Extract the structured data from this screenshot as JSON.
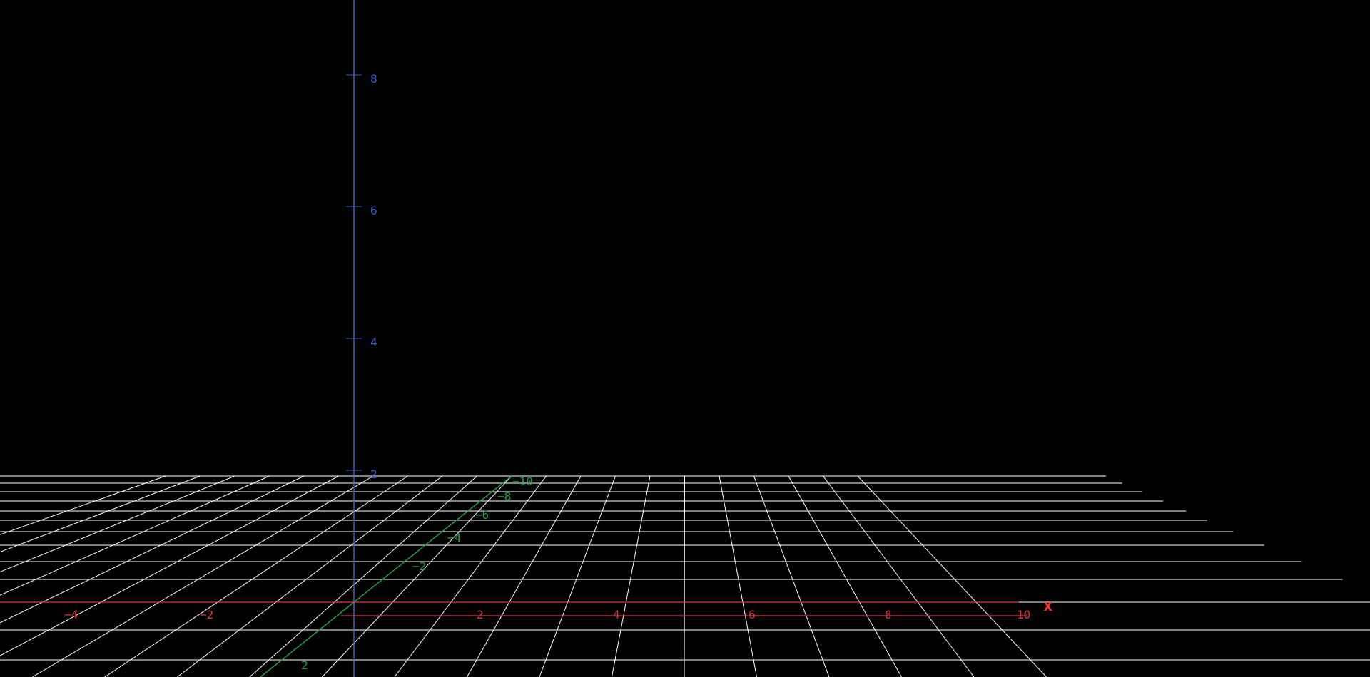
{
  "colors": {
    "background": "#000000",
    "grid": "#ffffff",
    "x_axis": "#d23a3a",
    "y_axis": "#1f9e46",
    "z_axis": "#3a5fcd",
    "x_axis_name": "#ff3030"
  },
  "scene": {
    "grid_visible": true,
    "axes": {
      "x": {
        "name": "x",
        "tick_labels": [
          "−4",
          "−2",
          "2",
          "4",
          "6",
          "8",
          "10"
        ]
      },
      "y": {
        "tick_labels": [
          "−10",
          "−8",
          "−6",
          "−4",
          "−2",
          "2"
        ]
      },
      "z": {
        "tick_labels": [
          "2",
          "4",
          "6",
          "8"
        ]
      }
    }
  }
}
